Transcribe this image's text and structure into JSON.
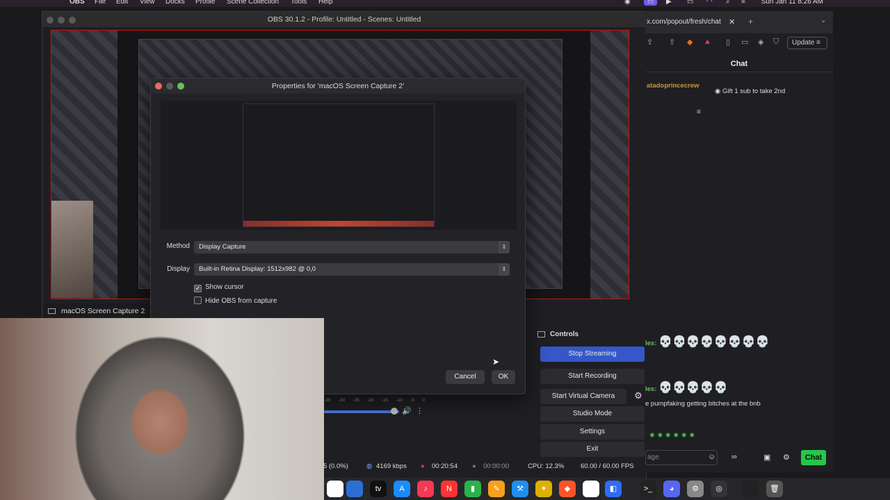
{
  "menubar": {
    "app": "OBS",
    "items": [
      "File",
      "Edit",
      "View",
      "Docks",
      "Profile",
      "Scene Collection",
      "Tools",
      "Help"
    ],
    "clock": "Sun Jan 11  8:26 AM"
  },
  "obs": {
    "title": "OBS 30.1.2 - Profile: Untitled - Scenes: Untitled",
    "source_label": "macOS Screen Capture 2",
    "controls": {
      "title": "Controls",
      "stop_streaming": "Stop Streaming",
      "start_recording": "Start Recording",
      "start_virtual_camera": "Start Virtual Camera",
      "studio_mode": "Studio Mode",
      "settings": "Settings",
      "exit": "Exit"
    },
    "mixer_scale": [
      "-35",
      "-30",
      "-25",
      "-20",
      "-15",
      "-10",
      "-5",
      "0"
    ],
    "status": {
      "dropped": "5 (0.0%)",
      "bitrate": "4169 kbps",
      "stream_time": "00:20:54",
      "record_time": "00:00:00",
      "cpu": "CPU: 12.3%",
      "fps": "60.00 / 60.00 FPS"
    }
  },
  "properties": {
    "title": "Properties for 'macOS Screen Capture 2'",
    "method_label": "Method",
    "method_value": "Display Capture",
    "display_label": "Display",
    "display_value": "Built-in Retina Display: 1512x982 @ 0,0",
    "show_cursor": "Show cursor",
    "show_cursor_checked": true,
    "hide_obs": "Hide OBS from capture",
    "hide_obs_checked": false,
    "cancel": "Cancel",
    "ok": "OK"
  },
  "browser": {
    "url": "x.com/popout/fresh/chat",
    "update": "Update",
    "chat_title": "Chat",
    "messages": [
      {
        "user": "atadoprincecrew",
        "text": "Gift 1 sub to take 2nd"
      },
      {
        "user": "les:",
        "text": "💀💀💀💀💀💀💀💀"
      },
      {
        "user": "les:",
        "text": "💀💀💀💀💀"
      },
      {
        "user": "",
        "text": "e pumpfaking getting bitches at the bnb"
      }
    ],
    "input_placeholder": "age",
    "chat_button": "Chat"
  }
}
